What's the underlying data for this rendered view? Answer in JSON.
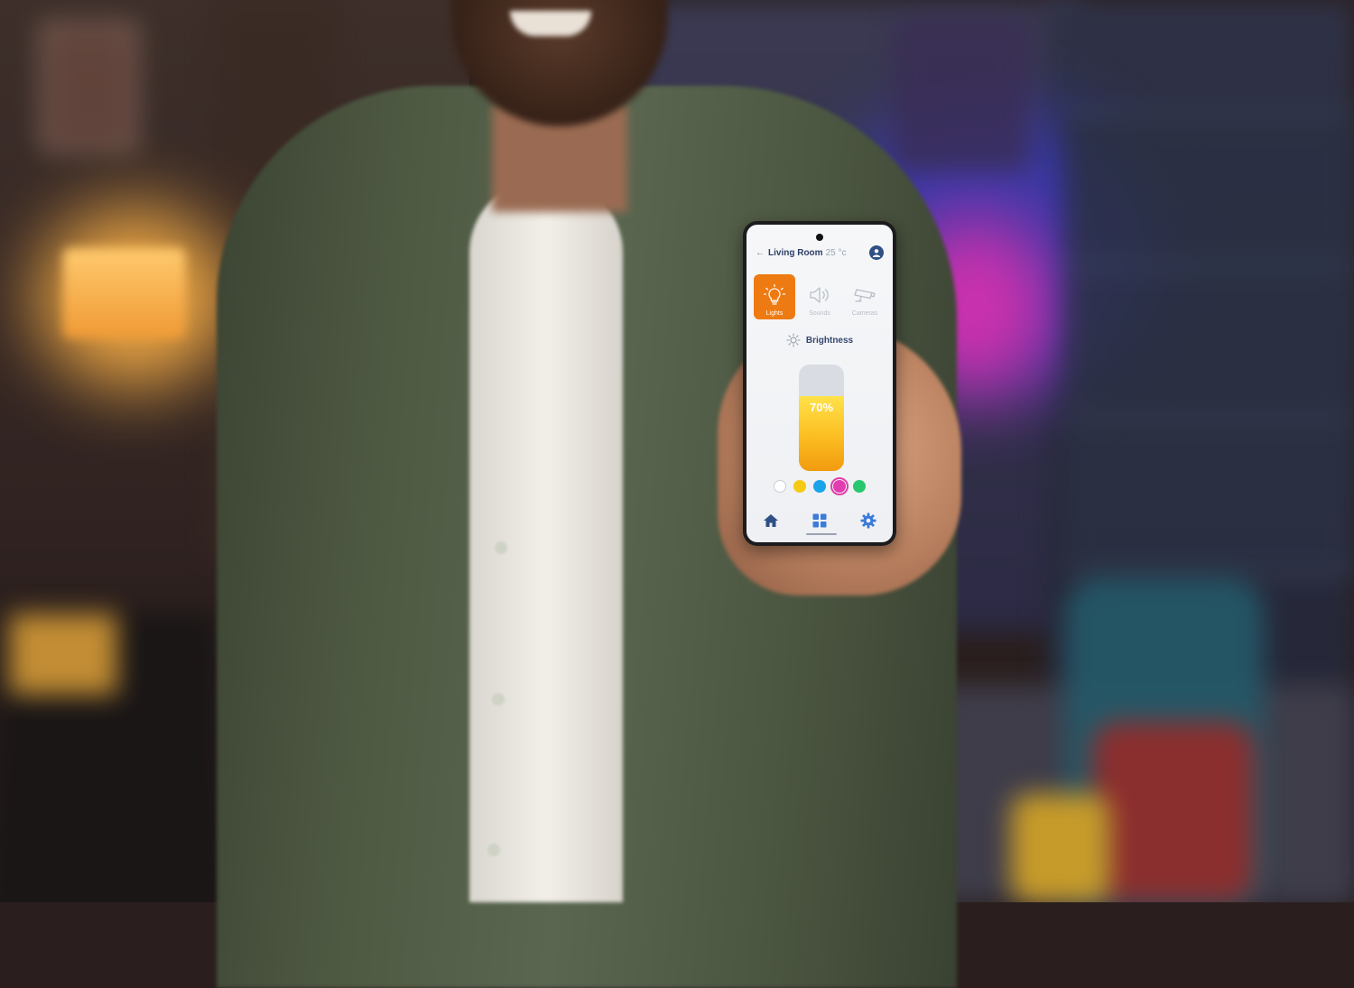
{
  "header": {
    "back_icon": "arrow-left-icon",
    "room": "Living Room",
    "temperature": "25 °c",
    "profile_icon": "user-avatar-icon"
  },
  "categories": [
    {
      "label": "Lights",
      "icon": "lightbulb-icon",
      "active": true
    },
    {
      "label": "Sounds",
      "icon": "speaker-icon",
      "active": false
    },
    {
      "label": "Cameras",
      "icon": "security-camera-icon",
      "active": false
    }
  ],
  "brightness": {
    "label": "Brightness",
    "icon": "sun-icon",
    "level": 0.7,
    "display": "70%"
  },
  "color_options": [
    {
      "name": "white",
      "color": "#ffffff",
      "selected": false
    },
    {
      "name": "yellow",
      "color": "#f6c913",
      "selected": false
    },
    {
      "name": "blue",
      "color": "#1aa3e8",
      "selected": false
    },
    {
      "name": "pink",
      "color": "#e23db0",
      "selected": true
    },
    {
      "name": "green",
      "color": "#28c76f",
      "selected": false
    }
  ],
  "bottom_nav": [
    {
      "icon": "home-icon",
      "active": true
    },
    {
      "icon": "grid-icon",
      "active": false
    },
    {
      "icon": "gear-icon",
      "active": false
    }
  ],
  "colors": {
    "accent": "#ee7a12",
    "nav_primary": "#2f4f86",
    "nav_inactive": "#3b7bd9"
  }
}
